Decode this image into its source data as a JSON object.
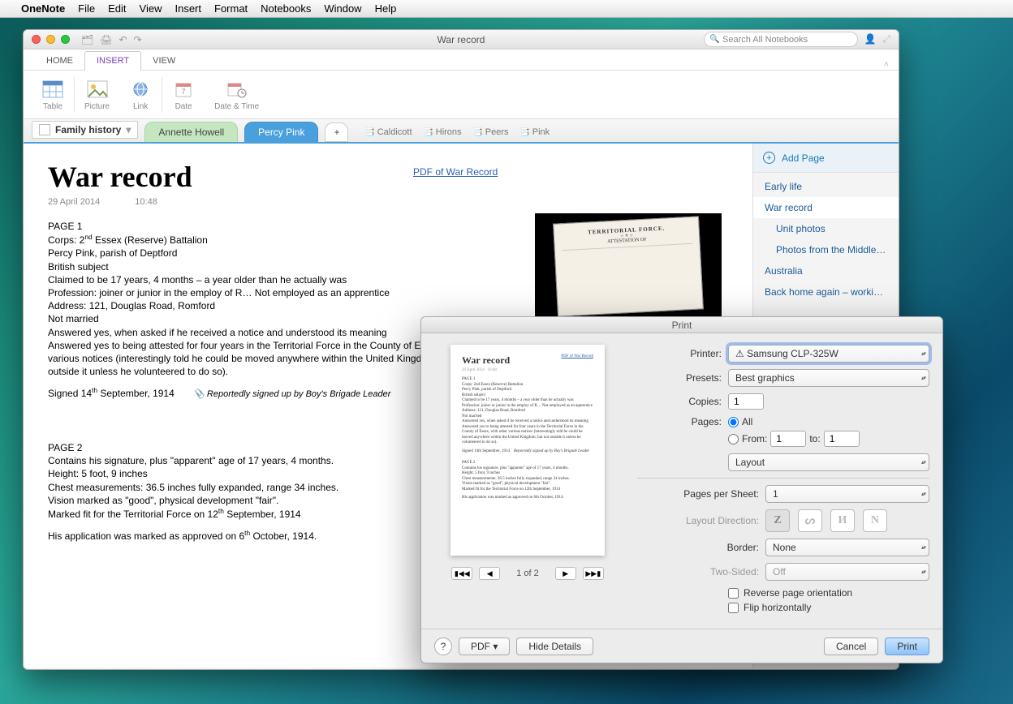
{
  "menubar": {
    "app": "OneNote",
    "items": [
      "File",
      "Edit",
      "View",
      "Insert",
      "Format",
      "Notebooks",
      "Window",
      "Help"
    ]
  },
  "window": {
    "title": "War record",
    "search_placeholder": "Search All Notebooks"
  },
  "ribbon_tabs": {
    "home": "HOME",
    "insert": "INSERT",
    "view": "VIEW"
  },
  "ribbon": {
    "table": "Table",
    "picture": "Picture",
    "link": "Link",
    "date": "Date",
    "date_time": "Date & Time"
  },
  "notebook": {
    "name": "Family history",
    "sections": {
      "annette": "Annette Howell",
      "percy": "Percy Pink"
    },
    "chips": [
      "Caldicott",
      "Hirons",
      "Peers",
      "Pink"
    ]
  },
  "pages_panel": {
    "add": "Add Page",
    "items": [
      {
        "label": "Early life",
        "child": false
      },
      {
        "label": "War record",
        "child": false,
        "active": true
      },
      {
        "label": "Unit photos",
        "child": true
      },
      {
        "label": "Photos from the Middle…",
        "child": true
      },
      {
        "label": "Australia",
        "child": false
      },
      {
        "label": "Back home again – worki…",
        "child": false
      }
    ]
  },
  "note": {
    "title": "War record",
    "date": "29 April 2014",
    "time": "10:48",
    "pdf_link": "PDF of War Record",
    "page1_header": "PAGE 1",
    "line_corps_pre": "Corps: 2",
    "line_corps_sup": "nd",
    "line_corps_post": " Essex (Reserve) Battalion",
    "line_parish": "Percy Pink, parish of Deptford",
    "line_subject": "British subject",
    "line_age": "Claimed to be 17 years, 4 months – a year older than he actually was",
    "line_profession": "Profession: joiner or junior in the employ of R… Not employed as an apprentice",
    "line_address": "Address: 121, Douglas Road, Romford",
    "line_married": "Not married",
    "line_notice": "Answered yes, when asked if he received a notice and understood its meaning",
    "line_attested": "Answered yes to being attested for four years in the Territorial Force in the County of Essex, with other various notices (interestingly told he could be moved anywhere within the United Kingdom, but not outside it unless he volunteered to do so).",
    "line_signed_pre": "Signed 14",
    "line_signed_sup": "th",
    "line_signed_post": " September, 1914",
    "reported": "Reportedly signed up by Boy's Brigade Leader",
    "page2_header": "PAGE 2",
    "p2_l1": "Contains his signature, plus \"apparent\" age of 17 years, 4 months.",
    "p2_l2": "Height: 5 foot, 9 inches",
    "p2_l3": "Chest measurements: 36.5 inches fully expanded, range 34 inches.",
    "p2_l4": "Vision marked as \"good\", physical development \"fair\".",
    "p2_l5_pre": "Marked fit for the Territorial Force on 12",
    "p2_l5_sup": "th",
    "p2_l5_post": " September, 1914",
    "p2_l6_pre": "His application was marked as approved on 6",
    "p2_l6_sup": "th",
    "p2_l6_post": " October, 1914.",
    "embedded_caption_top": "TERRITORIAL FORCE.",
    "embedded_caption_sub": "ATTESTATION OF"
  },
  "print": {
    "title": "Print",
    "printer_label": "Printer:",
    "printer_value": "⚠ Samsung CLP-325W",
    "presets_label": "Presets:",
    "presets_value": "Best graphics",
    "copies_label": "Copies:",
    "copies_value": "1",
    "pages_label": "Pages:",
    "all": "All",
    "from": "From:",
    "from_value": "1",
    "to": "to:",
    "to_value": "1",
    "layout_sec": "Layout",
    "pps_label": "Pages per Sheet:",
    "pps_value": "1",
    "layout_dir_label": "Layout Direction:",
    "border_label": "Border:",
    "border_value": "None",
    "twosided_label": "Two-Sided:",
    "twosided_value": "Off",
    "reverse": "Reverse page orientation",
    "flip": "Flip horizontally",
    "help": "?",
    "pdf_btn": "PDF ▾",
    "hide": "Hide Details",
    "cancel": "Cancel",
    "print_btn": "Print",
    "nav_text": "1 of 2",
    "preview_title": "War record"
  }
}
